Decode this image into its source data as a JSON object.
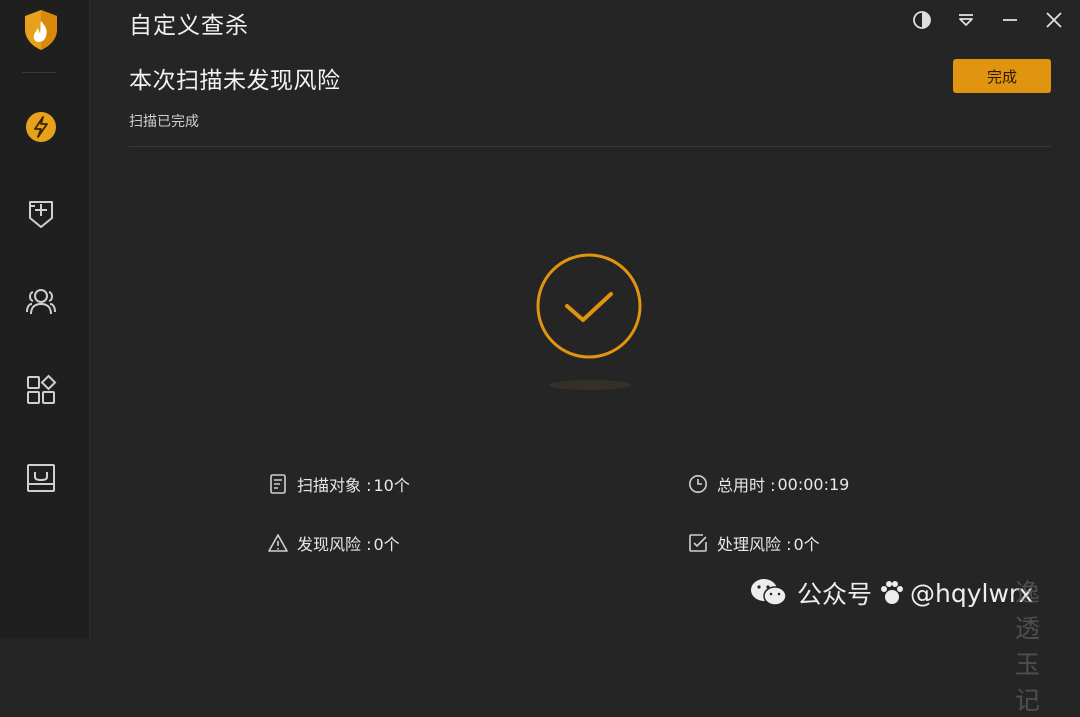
{
  "window": {
    "title": "自定义查杀"
  },
  "sidebar": {
    "items": [
      {
        "name": "scan",
        "icon": "lightning-icon",
        "active": true
      },
      {
        "name": "protection",
        "icon": "shield-plus-icon"
      },
      {
        "name": "users",
        "icon": "users-icon"
      },
      {
        "name": "tools",
        "icon": "apps-icon"
      },
      {
        "name": "box",
        "icon": "inbox-icon"
      }
    ]
  },
  "result": {
    "headline": "本次扫描未发现风险",
    "status": "扫描已完成",
    "done_label": "完成"
  },
  "stats": {
    "scan_objects": {
      "label": "扫描对象 : ",
      "value": "10个"
    },
    "total_time": {
      "label": "总用时 : ",
      "value": "00:00:19"
    },
    "found_risks": {
      "label": "发现风险 : ",
      "value": "0个"
    },
    "handled_risks": {
      "label": "处理风险 : ",
      "value": "0个"
    }
  },
  "watermark": {
    "account_label": "公众号",
    "faded_text": "逸透玉记",
    "handle": "@hqylwrx"
  },
  "colors": {
    "accent": "#e0940f",
    "background": "#252525",
    "sidebar": "#1f1f1f"
  }
}
